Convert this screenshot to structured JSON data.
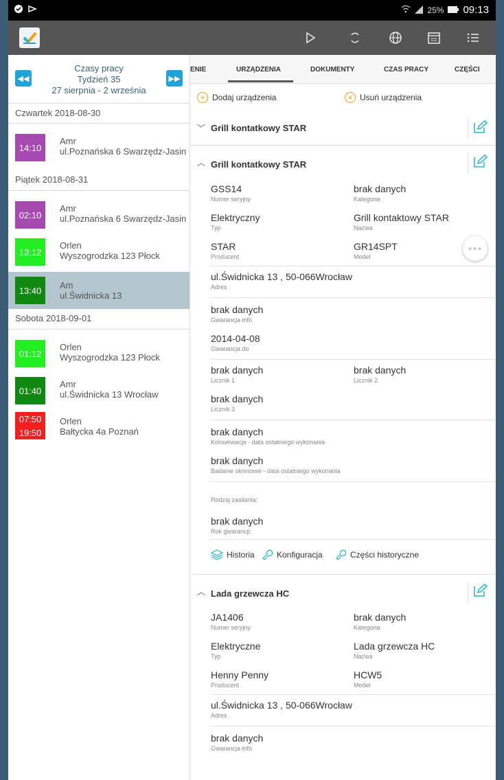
{
  "status_bar": {
    "battery": "25%",
    "time": "09:13"
  },
  "app_bar": {
    "icons": [
      "play-icon",
      "sync-icon",
      "globe-icon",
      "calendar-icon",
      "list-icon"
    ]
  },
  "schedule": {
    "title": "Czasy pracy",
    "week": "Tydzień 35",
    "range": "27 sierpnia - 2 września",
    "days": [
      {
        "label": "Czwartek 2018-08-30",
        "entries": [
          {
            "time": "14:10",
            "name": "Amr",
            "address": "ul.Poznańska 6 Swarzędz-Jasin",
            "color": "#a64ab0"
          }
        ]
      },
      {
        "label": "Piątek 2018-08-31",
        "entries": [
          {
            "time": "02:10",
            "name": "Amr",
            "address": "ul.Poznańska 6 Swarzędz-Jasin",
            "color": "#a64ab0"
          },
          {
            "time": "13:12",
            "name": "Orlen",
            "address": "Wyszogrodzka 123 Płock",
            "color": "#22ee22"
          },
          {
            "time": "13:40",
            "name": "Am",
            "address": "ul.Świdnicka 13",
            "color": "#118811",
            "selected": true
          }
        ]
      },
      {
        "label": "Sobota 2018-09-01",
        "entries": [
          {
            "time": "01:12",
            "name": "Orlen",
            "address": "Wyszogrodzka 123 Płock",
            "color": "#22ee22"
          },
          {
            "time": "01:40",
            "name": "Amr",
            "address": "ul.Świdnicka 13 Wrocław",
            "color": "#118811"
          },
          {
            "time": "07:50",
            "time2": "19:50",
            "name": "Orlen",
            "address": "Bałtycka 4a Poznań",
            "color": "#f22020"
          }
        ]
      }
    ]
  },
  "tabs": [
    "ENIE",
    "URZĄDZENIA",
    "DOKUMENTY",
    "CZAS PRACY",
    "CZĘŚCI"
  ],
  "active_tab": "URZĄDZENIA",
  "actions": {
    "add": "Dodaj urządzenia",
    "remove": "Usuń urządzenia"
  },
  "devices": [
    {
      "title": "Grill kontatkowy STAR",
      "expanded": false
    },
    {
      "title": "Grill kontatkowy STAR",
      "expanded": true,
      "serial": "GSS14",
      "serial_label": "Numer seryjny",
      "category": "brak danych",
      "category_label": "Kategoria",
      "type": "Elektryczny",
      "type_label": "Typ",
      "name": "Grill kontaktowy STAR",
      "name_label": "Nazwa",
      "producer": "STAR",
      "producer_label": "Producent",
      "model": "GR14SPT",
      "model_label": "Model",
      "address": "ul.Świdnicka 13 , 50-066Wrocław",
      "address_label": "Adres",
      "warranty_info": "brak danych",
      "warranty_info_label": "Gwarancja info",
      "warranty_to": "2014-04-08",
      "warranty_to_label": "Gwarancja do",
      "counter1": "brak danych",
      "counter1_label": "Licznik 1",
      "counter2": "brak danych",
      "counter2_label": "Licznik 2",
      "counter3": "brak danych",
      "counter3_label": "Licznik 3",
      "maintenance": "brak danych",
      "maintenance_label": "Konserwacja - data ostatniego wykonania",
      "inspection": "brak danych",
      "inspection_label": "Badanie okresowe - data ostatniego wykonania",
      "power_label": "Rodzaj zasilania:",
      "warranty_year": "brak danych",
      "warranty_year_label": "Rok gwarancji:",
      "links": [
        "Historia",
        "Konfiguracja",
        "Części historyczne"
      ]
    },
    {
      "title": "Lada grzewcza HC",
      "expanded": true,
      "serial": "JA1406",
      "serial_label": "Numer seryjny",
      "category": "brak danych",
      "category_label": "Kategoria",
      "type": "Elektryczne",
      "type_label": "Typ",
      "name": "Lada grzewcza HC",
      "name_label": "Nazwa",
      "producer": "Henny Penny",
      "producer_label": "Producent",
      "model": "HCW5",
      "model_label": "Model",
      "address": "ul.Świdnicka 13 , 50-066Wrocław",
      "address_label": "Adres",
      "warranty_info": "brak danych",
      "warranty_info_label": "Gwarancja info"
    }
  ],
  "colors": {
    "accent": "#1fa3d9",
    "orange": "#f39c12",
    "teal_icon": "#1fb5c8"
  }
}
